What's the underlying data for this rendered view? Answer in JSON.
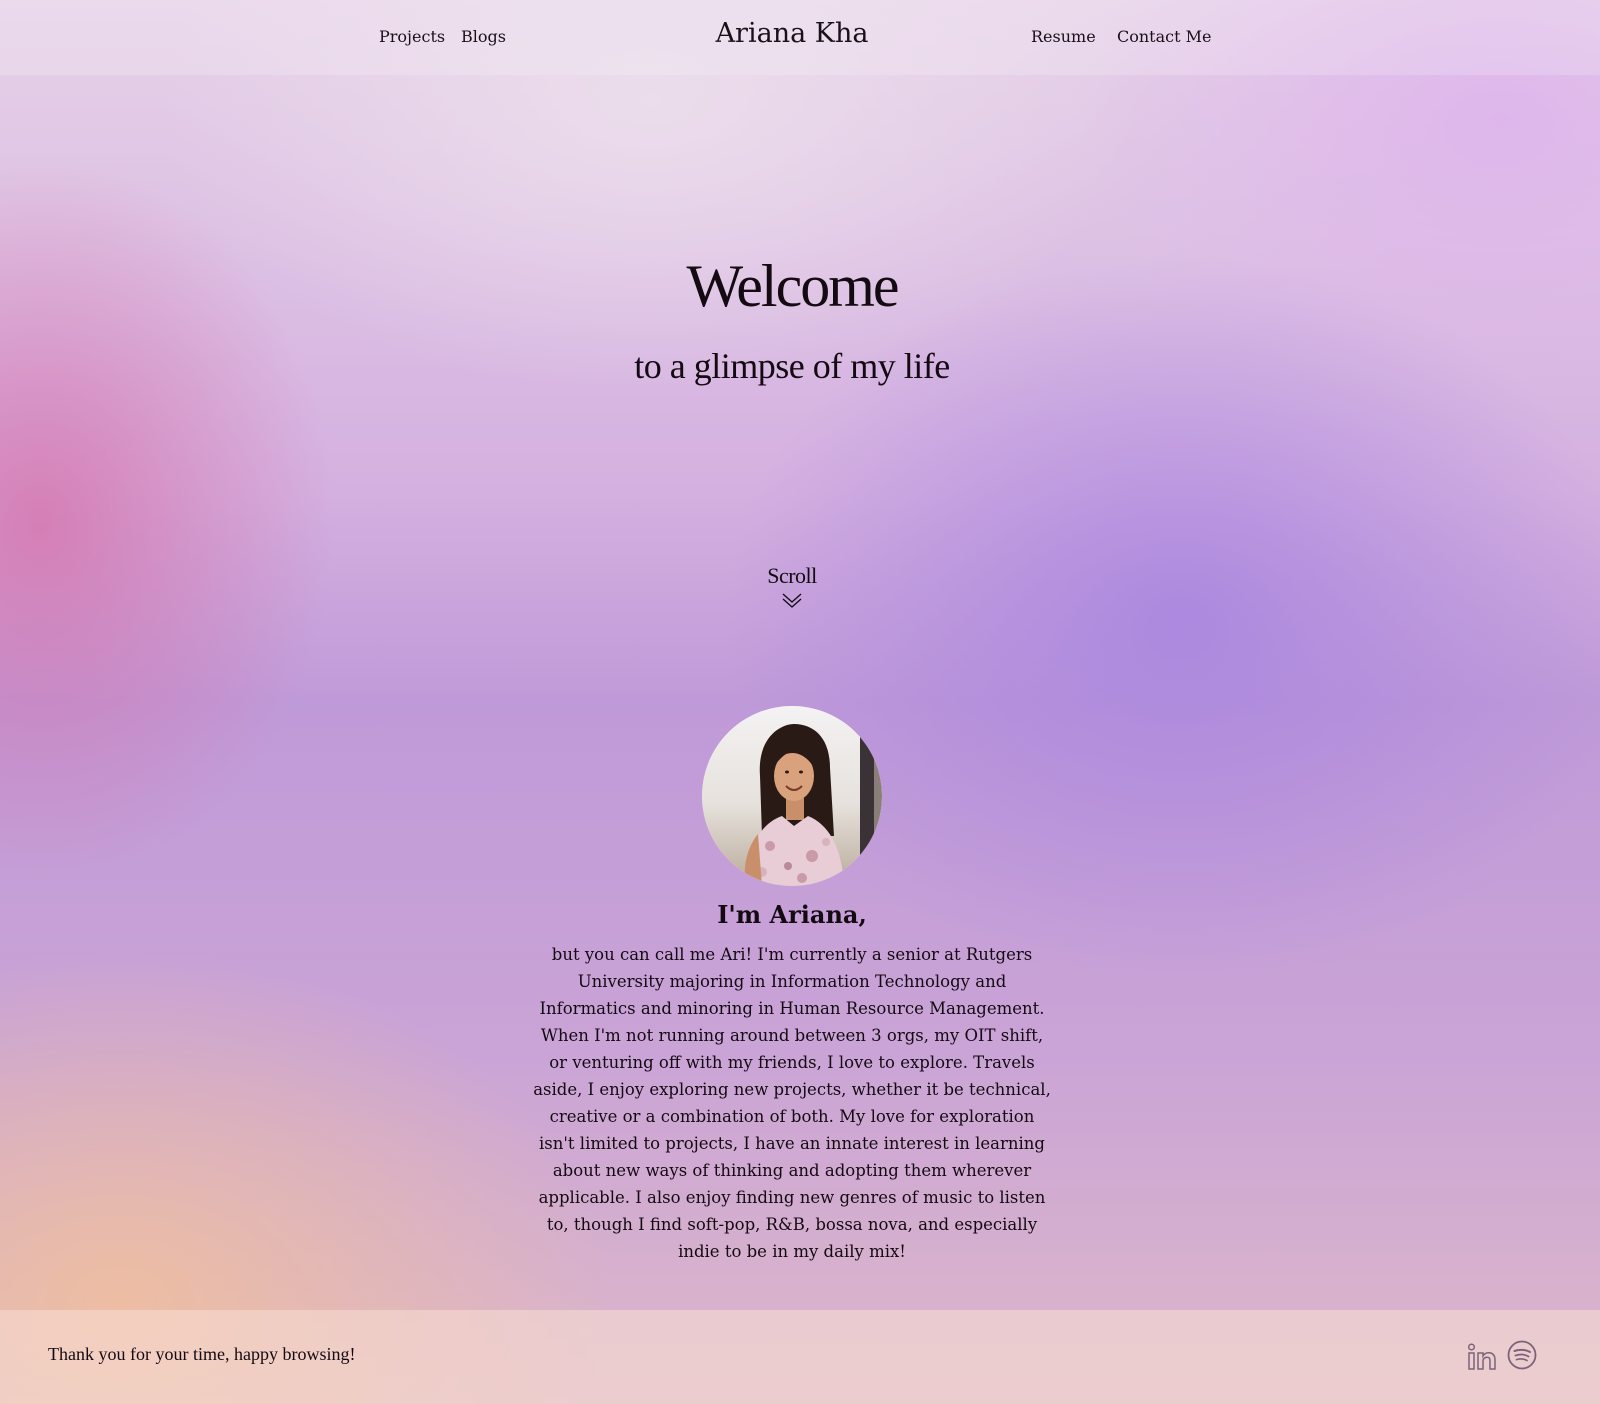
{
  "header": {
    "brand": "Ariana Kha",
    "nav_left": [
      "Projects",
      "Blogs"
    ],
    "nav_right": [
      "Resume",
      "Contact Me"
    ]
  },
  "hero": {
    "title": "Welcome",
    "subtitle": "to a glimpse of my life",
    "scroll_label": "Scroll",
    "scroll_icon": "double-chevron-down-icon"
  },
  "about": {
    "photo": "profile-photo",
    "heading": "I'm Ariana,",
    "body": "but you can call me Ari! I'm currently a senior at Rutgers University majoring in Information Technology and Informatics and minoring in Human Resource Management. When I'm not running around between 3 orgs, my OIT shift, or venturing off with my friends, I love to explore. Travels aside, I enjoy exploring new projects, whether it be technical, creative or a combination of both. My love for exploration isn't limited to projects, I have an innate interest in learning about new ways of thinking and adopting them wherever applicable. I also enjoy finding new genres of music to listen to, though I find soft-pop, R&B, bossa nova, and especially indie to be in my daily mix!"
  },
  "footer": {
    "message": "Thank you for your time, happy browsing!",
    "social_icons": [
      "linkedin-icon",
      "spotify-icon"
    ]
  },
  "colors": {
    "text": "#140a12",
    "gradient_pink": "#d670a8",
    "gradient_purple": "#a884e0",
    "gradient_peach": "#eebea0",
    "icon_gray": "#7a6478"
  }
}
